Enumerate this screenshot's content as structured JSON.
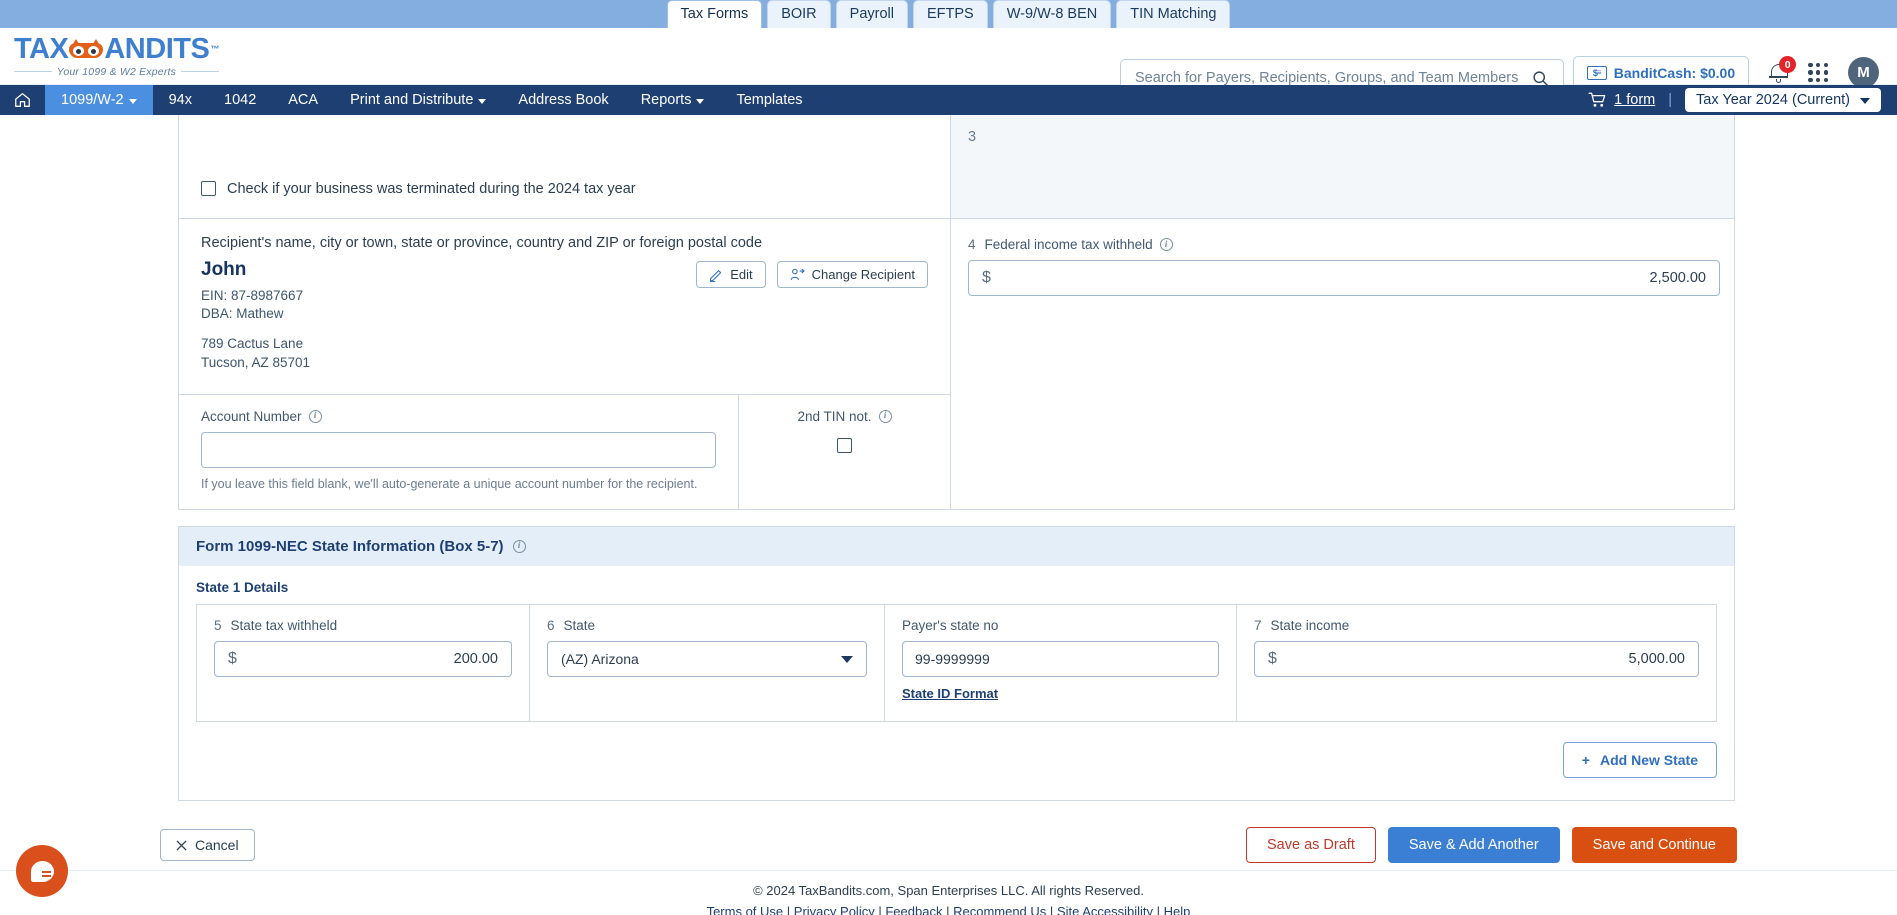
{
  "product_tabs": [
    {
      "label": "Tax Forms",
      "active": true
    },
    {
      "label": "BOIR",
      "active": false
    },
    {
      "label": "Payroll",
      "active": false
    },
    {
      "label": "EFTPS",
      "active": false
    },
    {
      "label": "W-9/W-8 BEN",
      "active": false
    },
    {
      "label": "TIN Matching",
      "active": false
    }
  ],
  "brand": {
    "name_part1": "TAX",
    "name_part2": "ANDITS",
    "tm": "™",
    "tagline": "Your 1099 & W2 Experts"
  },
  "search": {
    "placeholder": "Search for Payers, Recipients, Groups, and Team Members",
    "value": "",
    "icon": "search-icon"
  },
  "header_right": {
    "bandit_cash_label": "BanditCash: $0.00",
    "bandit_cash_icon": "cash-icon",
    "notification_icon": "bell-icon",
    "notification_count": "0",
    "apps_icon": "grid-apps-icon",
    "avatar_initial": "M"
  },
  "nav": {
    "home_icon": "home-icon",
    "items": [
      {
        "label": "1099/W-2",
        "caret": true,
        "active": true
      },
      {
        "label": "94x",
        "caret": false,
        "active": false
      },
      {
        "label": "1042",
        "caret": false,
        "active": false
      },
      {
        "label": "ACA",
        "caret": false,
        "active": false
      },
      {
        "label": "Print and Distribute",
        "caret": true,
        "active": false
      },
      {
        "label": "Address Book",
        "caret": false,
        "active": false
      },
      {
        "label": "Reports",
        "caret": true,
        "active": false
      },
      {
        "label": "Templates",
        "caret": false,
        "active": false
      }
    ],
    "cart_icon": "cart-icon",
    "cart_label": "1 form",
    "separator": "|",
    "tax_year": "Tax Year 2024 (Current)"
  },
  "form": {
    "terminated_checkbox_label": "Check if your business was terminated during the 2024 tax year",
    "terminated_checked": false,
    "box3_number": "3",
    "box3_value": "",
    "box4": {
      "number": "4",
      "label": "Federal income tax withheld",
      "info_icon": "info-icon",
      "currency": "$",
      "value": "2,500.00"
    },
    "recipient": {
      "heading": "Recipient's name, city or town, state or province, country and ZIP or foreign postal code",
      "name": "John",
      "ein": "EIN: 87-8987667",
      "dba": "DBA: Mathew",
      "address_line1": "789 Cactus Lane",
      "address_line2": "Tucson, AZ 85701",
      "edit_label": "Edit",
      "edit_icon": "pencil-icon",
      "change_label": "Change Recipient",
      "change_icon": "user-switch-icon"
    },
    "account_number": {
      "label": "Account Number",
      "info_icon": "info-icon",
      "value": "",
      "placeholder": "",
      "hint": "If you leave this field blank, we'll auto-generate a unique account number for the recipient."
    },
    "second_tin": {
      "label": "2nd TIN not.",
      "info_icon": "info-icon",
      "checked": false
    }
  },
  "state_panel": {
    "title": "Form 1099-NEC  State Information  (Box 5-7)",
    "info_icon": "info-icon",
    "subtitle": "State 1 Details",
    "fields": {
      "state_tax_withheld": {
        "number": "5",
        "label": "State tax withheld",
        "currency": "$",
        "value": "200.00"
      },
      "state": {
        "number": "6",
        "label": "State",
        "value": "(AZ) Arizona",
        "caret_icon": "chevron-down-icon"
      },
      "payer_state_no": {
        "label": "Payer's state no",
        "value": "99-9999999",
        "link": "State ID Format"
      },
      "state_income": {
        "number": "7",
        "label": "State income",
        "currency": "$",
        "value": "5,000.00"
      }
    },
    "add_new_state_label": "Add New State",
    "add_icon": "plus-icon"
  },
  "actions": {
    "cancel_label": "Cancel",
    "cancel_icon": "close-icon",
    "save_draft_label": "Save as Draft",
    "save_add_another_label": "Save & Add Another",
    "save_continue_label": "Save and Continue"
  },
  "footer": {
    "copyright": "© 2024 TaxBandits.com, Span Enterprises LLC. All rights Reserved.",
    "links": [
      {
        "label": "Terms of Use"
      },
      {
        "label": "Privacy Policy"
      },
      {
        "label": "Feedback"
      },
      {
        "label": "Recommend Us"
      },
      {
        "label": "Site Accessibility"
      },
      {
        "label": "Help"
      }
    ],
    "separator": "|"
  },
  "chat": {
    "icon": "chat-bubble-icon"
  },
  "colors": {
    "nav_blue": "#1e3f72",
    "accent_blue": "#4a8fe0",
    "brand_orange": "#e2601a",
    "danger_red": "#e3252b",
    "continue_orange": "#d94f12"
  }
}
